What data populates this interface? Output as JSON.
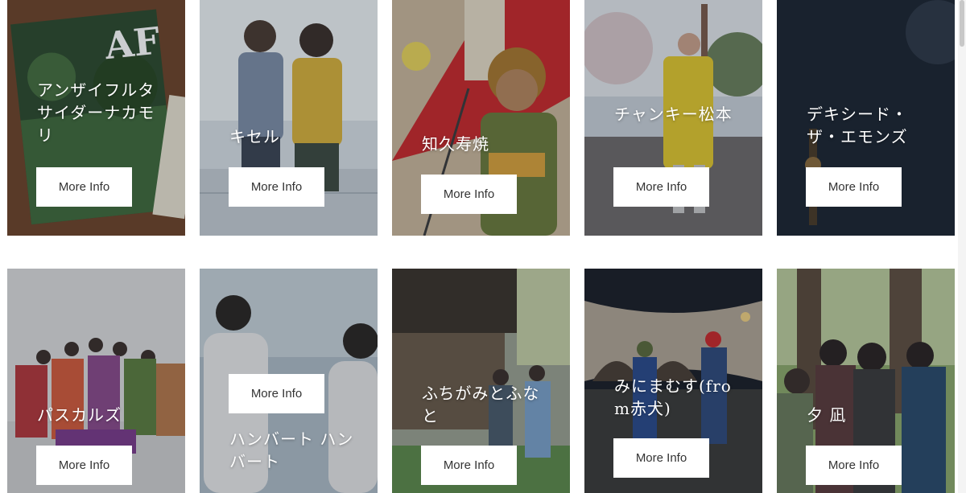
{
  "artists": [
    {
      "name": "アンザイフルタサイダーナカモリ",
      "button": "More Info"
    },
    {
      "name": "キセル",
      "button": "More Info"
    },
    {
      "name": "知久寿焼",
      "button": "More Info"
    },
    {
      "name": "チャンキー松本",
      "button": "More Info"
    },
    {
      "name": "デキシード・ザ・エモンズ",
      "button": "More Info"
    },
    {
      "name": "パスカルズ",
      "button": "More Info"
    },
    {
      "name": "ハンバート ハンバート",
      "button": "More Info"
    },
    {
      "name": "ふちがみとふなと",
      "button": "More Info"
    },
    {
      "name": "みにまむす(from赤犬)",
      "button": "More Info"
    },
    {
      "name": "夕 凪",
      "button": "More Info"
    }
  ]
}
